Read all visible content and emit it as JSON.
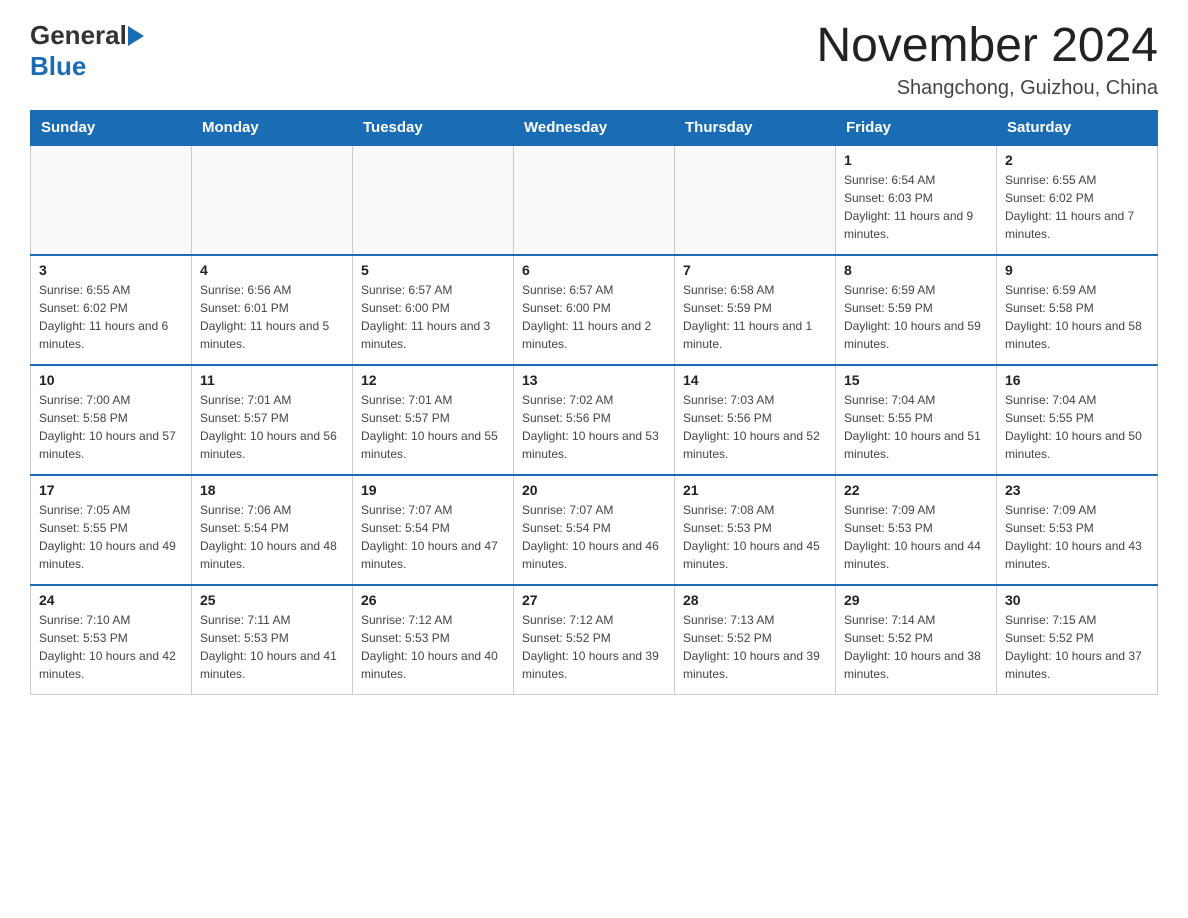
{
  "header": {
    "month_title": "November 2024",
    "location": "Shangchong, Guizhou, China",
    "logo_general": "General",
    "logo_blue": "Blue"
  },
  "weekdays": [
    "Sunday",
    "Monday",
    "Tuesday",
    "Wednesday",
    "Thursday",
    "Friday",
    "Saturday"
  ],
  "weeks": [
    [
      {
        "day": "",
        "info": ""
      },
      {
        "day": "",
        "info": ""
      },
      {
        "day": "",
        "info": ""
      },
      {
        "day": "",
        "info": ""
      },
      {
        "day": "",
        "info": ""
      },
      {
        "day": "1",
        "info": "Sunrise: 6:54 AM\nSunset: 6:03 PM\nDaylight: 11 hours and 9 minutes."
      },
      {
        "day": "2",
        "info": "Sunrise: 6:55 AM\nSunset: 6:02 PM\nDaylight: 11 hours and 7 minutes."
      }
    ],
    [
      {
        "day": "3",
        "info": "Sunrise: 6:55 AM\nSunset: 6:02 PM\nDaylight: 11 hours and 6 minutes."
      },
      {
        "day": "4",
        "info": "Sunrise: 6:56 AM\nSunset: 6:01 PM\nDaylight: 11 hours and 5 minutes."
      },
      {
        "day": "5",
        "info": "Sunrise: 6:57 AM\nSunset: 6:00 PM\nDaylight: 11 hours and 3 minutes."
      },
      {
        "day": "6",
        "info": "Sunrise: 6:57 AM\nSunset: 6:00 PM\nDaylight: 11 hours and 2 minutes."
      },
      {
        "day": "7",
        "info": "Sunrise: 6:58 AM\nSunset: 5:59 PM\nDaylight: 11 hours and 1 minute."
      },
      {
        "day": "8",
        "info": "Sunrise: 6:59 AM\nSunset: 5:59 PM\nDaylight: 10 hours and 59 minutes."
      },
      {
        "day": "9",
        "info": "Sunrise: 6:59 AM\nSunset: 5:58 PM\nDaylight: 10 hours and 58 minutes."
      }
    ],
    [
      {
        "day": "10",
        "info": "Sunrise: 7:00 AM\nSunset: 5:58 PM\nDaylight: 10 hours and 57 minutes."
      },
      {
        "day": "11",
        "info": "Sunrise: 7:01 AM\nSunset: 5:57 PM\nDaylight: 10 hours and 56 minutes."
      },
      {
        "day": "12",
        "info": "Sunrise: 7:01 AM\nSunset: 5:57 PM\nDaylight: 10 hours and 55 minutes."
      },
      {
        "day": "13",
        "info": "Sunrise: 7:02 AM\nSunset: 5:56 PM\nDaylight: 10 hours and 53 minutes."
      },
      {
        "day": "14",
        "info": "Sunrise: 7:03 AM\nSunset: 5:56 PM\nDaylight: 10 hours and 52 minutes."
      },
      {
        "day": "15",
        "info": "Sunrise: 7:04 AM\nSunset: 5:55 PM\nDaylight: 10 hours and 51 minutes."
      },
      {
        "day": "16",
        "info": "Sunrise: 7:04 AM\nSunset: 5:55 PM\nDaylight: 10 hours and 50 minutes."
      }
    ],
    [
      {
        "day": "17",
        "info": "Sunrise: 7:05 AM\nSunset: 5:55 PM\nDaylight: 10 hours and 49 minutes."
      },
      {
        "day": "18",
        "info": "Sunrise: 7:06 AM\nSunset: 5:54 PM\nDaylight: 10 hours and 48 minutes."
      },
      {
        "day": "19",
        "info": "Sunrise: 7:07 AM\nSunset: 5:54 PM\nDaylight: 10 hours and 47 minutes."
      },
      {
        "day": "20",
        "info": "Sunrise: 7:07 AM\nSunset: 5:54 PM\nDaylight: 10 hours and 46 minutes."
      },
      {
        "day": "21",
        "info": "Sunrise: 7:08 AM\nSunset: 5:53 PM\nDaylight: 10 hours and 45 minutes."
      },
      {
        "day": "22",
        "info": "Sunrise: 7:09 AM\nSunset: 5:53 PM\nDaylight: 10 hours and 44 minutes."
      },
      {
        "day": "23",
        "info": "Sunrise: 7:09 AM\nSunset: 5:53 PM\nDaylight: 10 hours and 43 minutes."
      }
    ],
    [
      {
        "day": "24",
        "info": "Sunrise: 7:10 AM\nSunset: 5:53 PM\nDaylight: 10 hours and 42 minutes."
      },
      {
        "day": "25",
        "info": "Sunrise: 7:11 AM\nSunset: 5:53 PM\nDaylight: 10 hours and 41 minutes."
      },
      {
        "day": "26",
        "info": "Sunrise: 7:12 AM\nSunset: 5:53 PM\nDaylight: 10 hours and 40 minutes."
      },
      {
        "day": "27",
        "info": "Sunrise: 7:12 AM\nSunset: 5:52 PM\nDaylight: 10 hours and 39 minutes."
      },
      {
        "day": "28",
        "info": "Sunrise: 7:13 AM\nSunset: 5:52 PM\nDaylight: 10 hours and 39 minutes."
      },
      {
        "day": "29",
        "info": "Sunrise: 7:14 AM\nSunset: 5:52 PM\nDaylight: 10 hours and 38 minutes."
      },
      {
        "day": "30",
        "info": "Sunrise: 7:15 AM\nSunset: 5:52 PM\nDaylight: 10 hours and 37 minutes."
      }
    ]
  ]
}
